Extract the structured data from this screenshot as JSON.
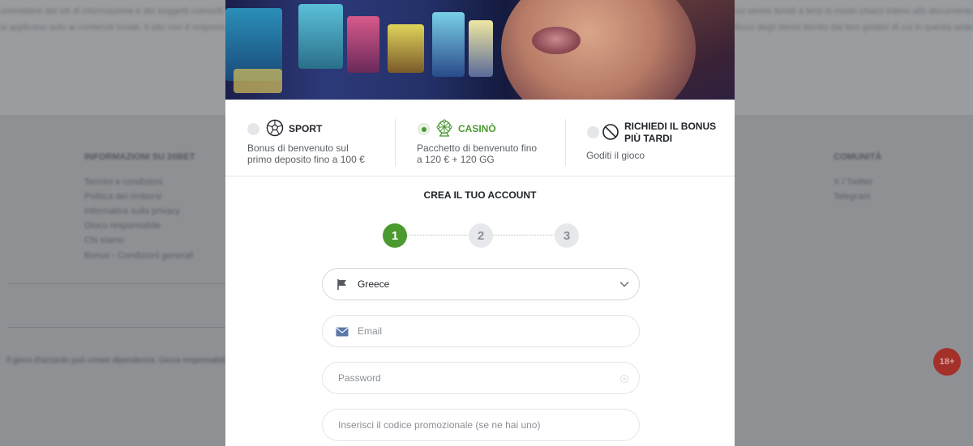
{
  "background": {
    "top_text_line1": "ommettere dei siti di informazione e dei soggetti coinvolti nella promozione del gioco, fra le altre cose da questo sito potrebbero venire forniti a terzi in modo chiaro intimo allo documento",
    "top_text_line2": "si applicano solo ai contenuti inviati. Il sito non è responsabile per i contenuti presenti su siti esterni e per l'utilizzo degli stessi fornito dai loro gestori di cui in questa sede",
    "footer_col1_title": "INFORMAZIONI SU 20BET",
    "footer_col1_links": [
      "Termini e condizioni",
      "Politica dei rimborsi",
      "Informativa sulla privacy",
      "Gioco responsabile",
      "Chi siamo",
      "Bonus - Condizioni generali"
    ],
    "footer_col2_title": "COMUNITÀ",
    "footer_col2_links": [
      "X / Twitter",
      "Telegram"
    ],
    "disclaimer": "Il gioco d'azzardo può creare dipendenza. Gioca responsabilmente",
    "age_badge": "18+"
  },
  "bonus_options": [
    {
      "id": "sport",
      "title": "SPORT",
      "description_line1": "Bonus di benvenuto sul",
      "description_line2": "primo deposito fino a 100 €",
      "selected": false,
      "icon": "soccer-ball-icon"
    },
    {
      "id": "casino",
      "title": "CASINÒ",
      "description_line1": "Pacchetto di benvenuto fino",
      "description_line2": "a 120 € + 120 GG",
      "selected": true,
      "icon": "ferris-wheel-icon"
    },
    {
      "id": "later",
      "title_line1": "RICHIEDI IL BONUS",
      "title_line2": "PIÙ TARDI",
      "description_line1": "Goditi il gioco",
      "selected": false,
      "icon": "no-entry-icon"
    }
  ],
  "form": {
    "title": "CREA IL TUO ACCOUNT",
    "steps": [
      "1",
      "2",
      "3"
    ],
    "active_step": 1,
    "country": {
      "value": "Greece",
      "icon": "flag-icon"
    },
    "email": {
      "placeholder": "Email",
      "icon": "envelope-icon"
    },
    "password": {
      "placeholder": "Password",
      "icon": "eye-icon"
    },
    "promo": {
      "placeholder": "Inserisci il codice promozionale (se ne hai uno)"
    }
  },
  "colors": {
    "accent_green": "#4a9a2f",
    "overlay_gray": "#8e9094",
    "age_badge_red": "#a4302a"
  }
}
